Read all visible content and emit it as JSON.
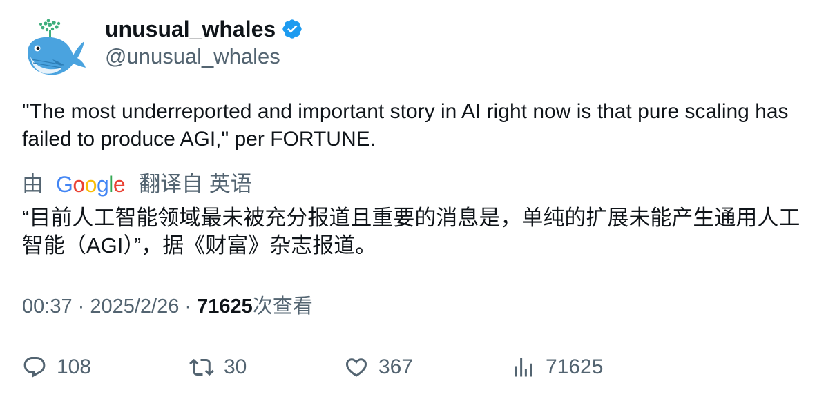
{
  "author": {
    "display_name": "unusual_whales",
    "handle": "@unusual_whales",
    "verified": true,
    "avatar_icon": "whale-avatar-icon",
    "verified_color": "#1d9bf0"
  },
  "tweet": {
    "text": "\"The most underreported and important story in AI right now is that pure scaling has failed to produce AGI,\" per FORTUNE."
  },
  "translation": {
    "by_label": "由",
    "provider": "Google",
    "action_label": "翻译自 英语",
    "text": "“目前人工智能领域最未被充分报道且重要的消息是，单纯的扩展未能产生通用人工智能（AGI）”，据《财富》杂志报道。"
  },
  "meta": {
    "time": "00:37",
    "date": "2025/2/26",
    "separator": " · ",
    "views_count": "71625",
    "views_label": "次查看"
  },
  "actions": {
    "replies": "108",
    "retweets": "30",
    "likes": "367",
    "views": "71625"
  },
  "colors": {
    "text_primary": "#0f1419",
    "text_secondary": "#536471",
    "accent": "#1d9bf0"
  }
}
